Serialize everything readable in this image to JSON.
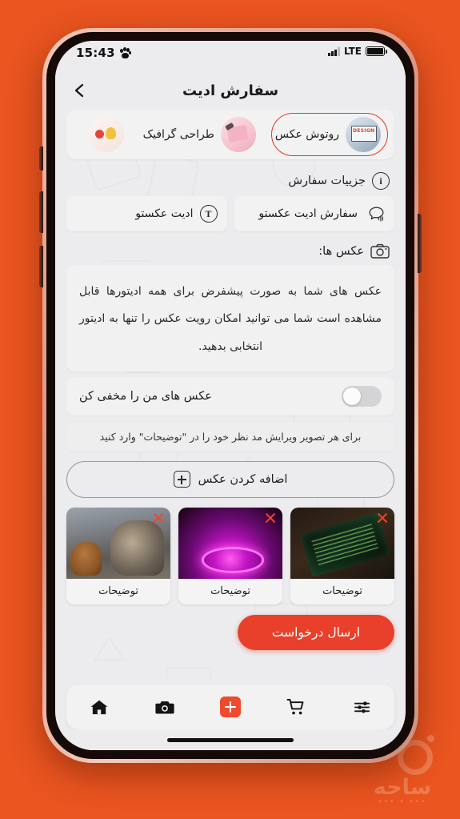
{
  "theme": {
    "background": "#ea5520",
    "accent": "#e8402a",
    "screen_bg": "#ececee",
    "card_bg": "#f2f2f3"
  },
  "watermark": {
    "text": "ساحه",
    "dots": "••• • •••"
  },
  "status_bar": {
    "time": "15:43",
    "paw_icon": "paw-icon",
    "signal_icon": "signal-bars-icon",
    "network": "LTE",
    "battery_icon": "battery-icon"
  },
  "header": {
    "back_icon": "back-chevron-icon",
    "title": "سفارش ادیت"
  },
  "categories": [
    {
      "label": "روتوش عکس",
      "selected": true,
      "thumb": "design-monitor-thumb"
    },
    {
      "label": "طراحی گرافیک",
      "selected": false,
      "thumb": "graphic-pink-thumb"
    },
    {
      "label": "",
      "selected": false,
      "thumb": "sweets-thumb"
    }
  ],
  "order_details": {
    "heading": "جزییات سفارش",
    "heading_icon": "info-circle-icon",
    "fields": [
      {
        "value": "ادیت عکستو",
        "icon": "text-t-circle-icon"
      },
      {
        "value": "سفارش ادیت عکستو",
        "icon": "voice-message-icon"
      }
    ]
  },
  "photos_section": {
    "heading": "عکس ها:",
    "heading_icon": "camera-icon",
    "info_text": "عکس های شما به صورت پیشفرض برای همه ادیتورها قابل مشاهده است شما می توانید امکان رویت عکس را تنها به ادیتور انتخابی بدهید.",
    "hide_toggle": {
      "label": "عکس های من را مخفی کن",
      "enabled": false
    },
    "hint": "برای هر تصویر ویرایش مد نظر خود را در \"توضیحات\" وارد کنید",
    "add_photo_label": "اضافه کردن عکس",
    "add_photo_icon": "plus-square-icon",
    "thumbnails": [
      {
        "caption": "توضیحات",
        "remove_icon": "close-x-icon",
        "image": "dogs-photo"
      },
      {
        "caption": "توضیحات",
        "remove_icon": "close-x-icon",
        "image": "neon-photo"
      },
      {
        "caption": "توضیحات",
        "remove_icon": "close-x-icon",
        "image": "phone-code-photo"
      }
    ]
  },
  "submit": {
    "label": "ارسال درخواست"
  },
  "bottom_nav": [
    {
      "icon": "sliders-filter-icon",
      "active": false
    },
    {
      "icon": "shopping-cart-icon",
      "active": false
    },
    {
      "icon": "plus-square-red-icon",
      "active": true
    },
    {
      "icon": "camera-solid-icon",
      "active": false
    },
    {
      "icon": "home-icon",
      "active": false
    }
  ]
}
